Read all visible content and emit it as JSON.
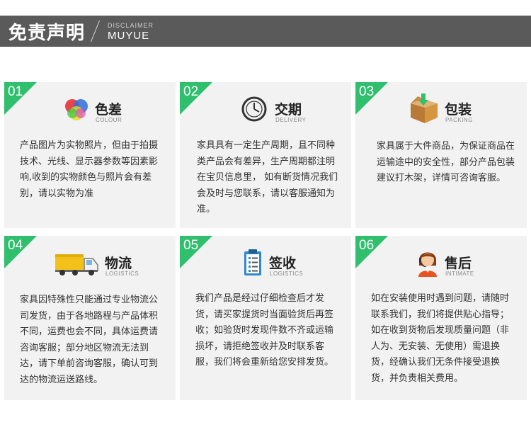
{
  "header": {
    "title": "免责声明",
    "subtitle_small": "DISCLAIMER",
    "subtitle_large": "MUYUE"
  },
  "colors": {
    "header_bg": "#5a5a5a",
    "card_bg": "#f2f2f2",
    "badge": "#2fbf6d"
  },
  "cards": [
    {
      "number": "01",
      "title": "色差",
      "subtitle": "COLOUR",
      "icon": "color-circles-icon",
      "body": "产品图片为实物照片，但由于拍摄技术、光线、显示器参数等因素影响,收到的实物颜色与照片会有差别，请以实物为准"
    },
    {
      "number": "02",
      "title": "交期",
      "subtitle": "DELIVERY",
      "icon": "clock-icon",
      "body": "家具具有一定生产周期，且不同种类产品会有差异，生产周期都注明在宝贝信息里， 如有断货情况我们会及时与您联系，请以客服通知为准。"
    },
    {
      "number": "03",
      "title": "包装",
      "subtitle": "PACKING",
      "icon": "box-icon",
      "body": "家具属于大件商品，为保证商品在运输途中的安全性，部分产品包装建议打木架，详情可咨询客服。"
    },
    {
      "number": "04",
      "title": "物流",
      "subtitle": "LOGISTICS",
      "icon": "truck-icon",
      "body": "家具因特殊性只能通过专业物流公司发货，由于各地路程与产品体积不同，运费也会不同，具体运费请咨询客服；部分地区物流无法到达，请下单前咨询客服，确认可到达的物流运送路线。"
    },
    {
      "number": "05",
      "title": "签收",
      "subtitle": "LOGISTICS",
      "icon": "clipboard-icon",
      "body": "我们产品是经过仔细检查后才发货，请买家提货时当面验货后再签收；如验货时发现件数不齐或运输损坏，请拒绝签收并及时联系客服，我们将会重新给您安排发货。"
    },
    {
      "number": "06",
      "title": "售后",
      "subtitle": "INTIMATE",
      "icon": "service-agent-icon",
      "body": "如在安装使用时遇到问题，请随时联系我们，我们将提供贴心指导；  如在收到货物后发现质量问题（非人为、无安装、无使用）需退换货，经确认我们无条件接受退换货，并负责相关费用。"
    }
  ]
}
